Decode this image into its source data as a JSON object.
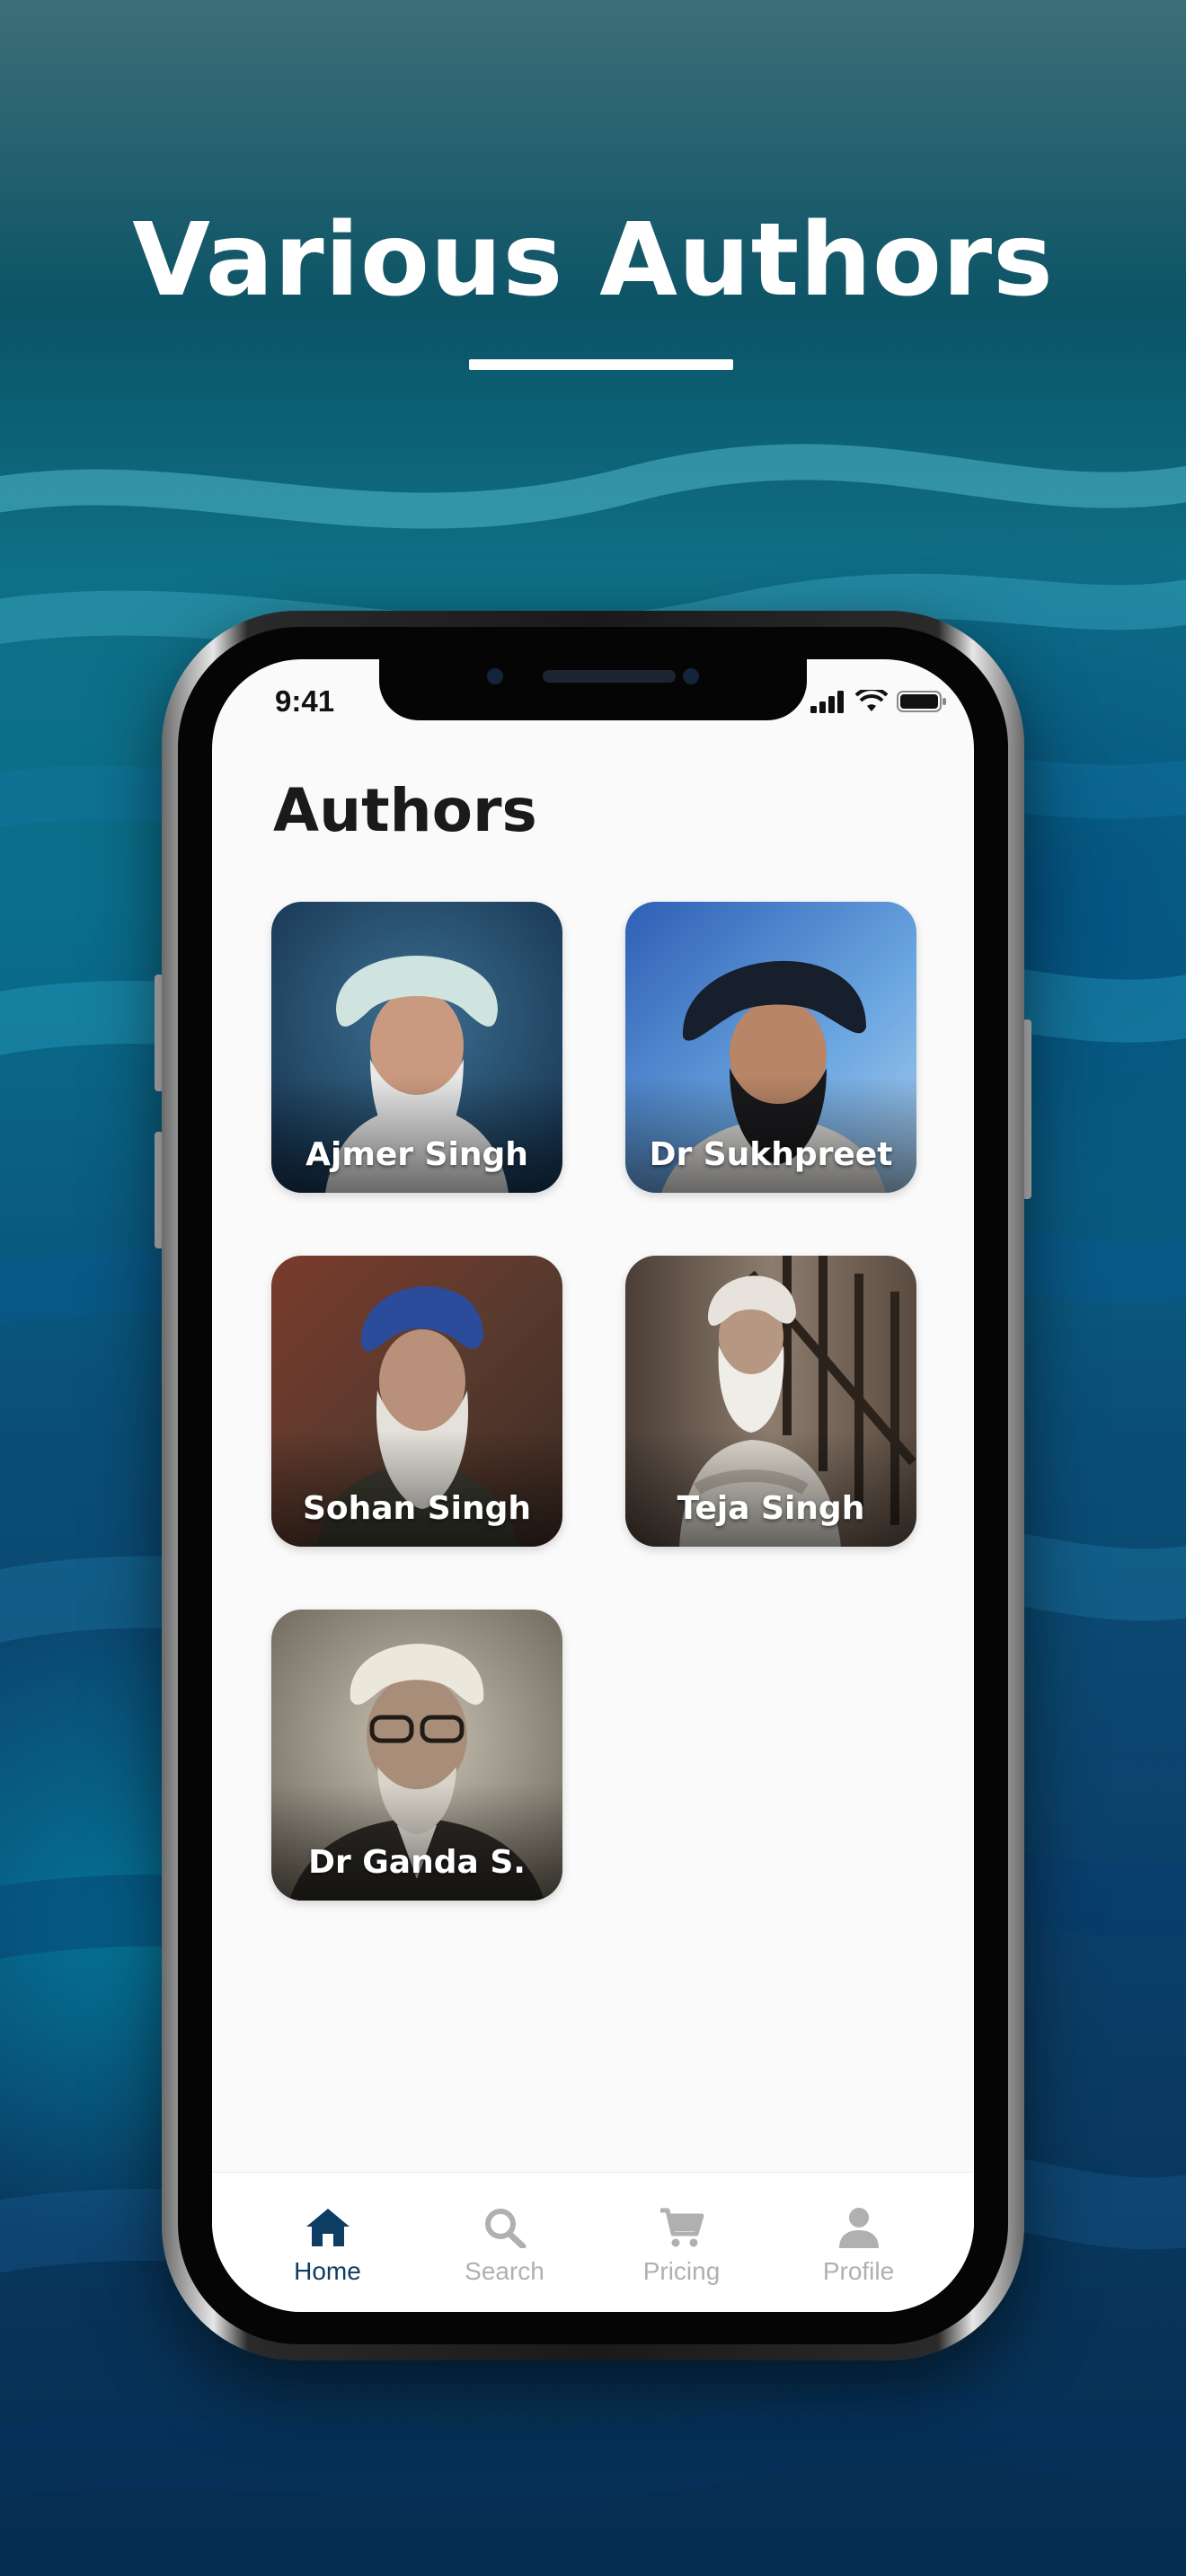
{
  "promo": {
    "headline": "Various Authors"
  },
  "status_bar": {
    "time": "9:41"
  },
  "page": {
    "title": "Authors"
  },
  "authors": [
    {
      "name": "Ajmer Singh",
      "turban": "#cfe3df",
      "bg": "#28506f"
    },
    {
      "name": "Dr Sukhpreet",
      "turban": "#171e2c",
      "bg": "#3c7ac8"
    },
    {
      "name": "Sohan Singh",
      "turban": "#2b4b9b",
      "bg": "#5a3a2e"
    },
    {
      "name": "Teja Singh",
      "turban": "#e7e3dc",
      "bg": "#7b6a5c"
    },
    {
      "name": "Dr Ganda S.",
      "turban": "#ece7db",
      "bg": "#8a8375"
    }
  ],
  "tabbar": {
    "items": [
      {
        "label": "Home",
        "icon": "home-icon",
        "active": true
      },
      {
        "label": "Search",
        "icon": "search-icon",
        "active": false
      },
      {
        "label": "Pricing",
        "icon": "cart-icon",
        "active": false
      },
      {
        "label": "Profile",
        "icon": "person-icon",
        "active": false
      }
    ]
  },
  "colors": {
    "accent": "#0e3d63",
    "inactive": "#b0b0b0"
  }
}
